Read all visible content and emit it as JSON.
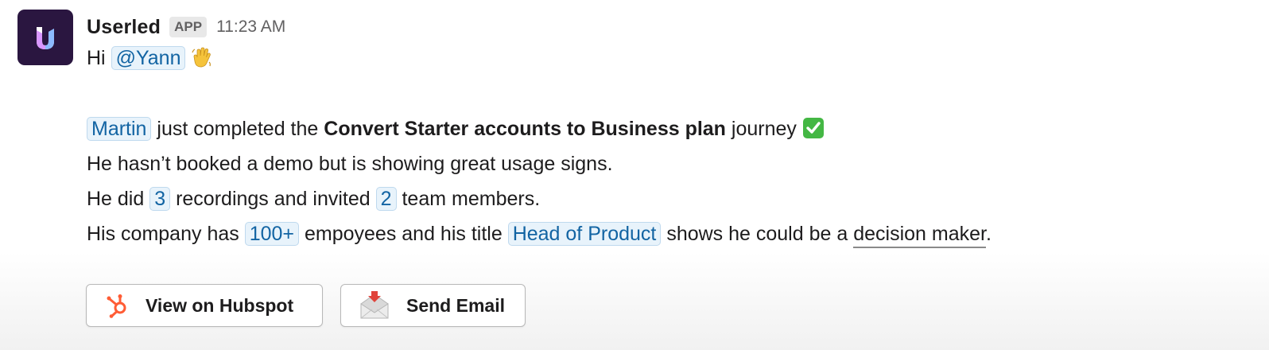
{
  "message": {
    "sender": "Userled",
    "badge": "APP",
    "timestamp": "11:23 AM",
    "greeting": {
      "prefix": "Hi",
      "mention": "@Yann",
      "emoji_icon": "waving-hand-emoji"
    },
    "line1": {
      "name": "Martin",
      "mid": "just completed the",
      "journey": "Convert Starter accounts to Business plan",
      "suffix": "journey",
      "emoji_icon": "check-mark-button-emoji"
    },
    "line2": "He hasn’t booked a demo but is showing great usage signs.",
    "line3": {
      "prefix": "He did",
      "recordings": "3",
      "mid": "recordings and invited",
      "members": "2",
      "suffix": "team members."
    },
    "line4": {
      "prefix": "His company has",
      "employees": "100+",
      "mid": "empoyees and his title",
      "title": "Head of Product",
      "suffix": "shows he could be a",
      "underlined": "decision maker",
      "end": "."
    }
  },
  "buttons": {
    "hubspot": {
      "label": "View on Hubspot",
      "icon": "hubspot-icon"
    },
    "email": {
      "label": "Send Email",
      "icon": "envelope-icon"
    }
  },
  "colors": {
    "avatar_bg": "#2a1640",
    "mention_bg": "#e8f3fb",
    "mention_text": "#1264a3",
    "hubspot_orange": "#ff5c35",
    "check_green": "#44b744"
  }
}
